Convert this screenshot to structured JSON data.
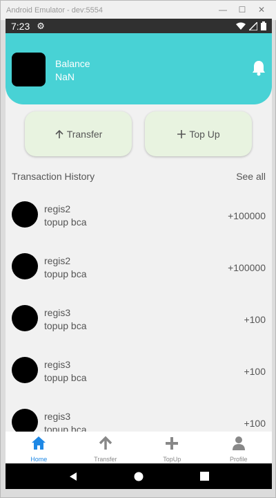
{
  "emulator": {
    "title": "Android Emulator - dev:5554"
  },
  "statusbar": {
    "time": "7:23"
  },
  "header": {
    "balance_label": "Balance",
    "balance_value": "NaN"
  },
  "actions": {
    "transfer_label": "Transfer",
    "topup_label": "Top Up"
  },
  "history": {
    "title": "Transaction History",
    "see_all": "See all",
    "items": [
      {
        "name": "regis2",
        "desc": "topup bca",
        "amount": "+100000"
      },
      {
        "name": "regis2",
        "desc": "topup bca",
        "amount": "+100000"
      },
      {
        "name": "regis3",
        "desc": "topup bca",
        "amount": "+100"
      },
      {
        "name": "regis3",
        "desc": "topup bca",
        "amount": "+100"
      },
      {
        "name": "regis3",
        "desc": "topup bca",
        "amount": "+100"
      }
    ]
  },
  "nav": {
    "items": [
      {
        "label": "Home",
        "icon": "home-icon",
        "active": true
      },
      {
        "label": "Transfer",
        "icon": "arrow-up-icon",
        "active": false
      },
      {
        "label": "TopUp",
        "icon": "plus-icon",
        "active": false
      },
      {
        "label": "Profile",
        "icon": "person-icon",
        "active": false
      }
    ]
  },
  "colors": {
    "header": "#48d2d5",
    "accent": "#1e88e5",
    "button_bg": "#e8f3e0"
  }
}
